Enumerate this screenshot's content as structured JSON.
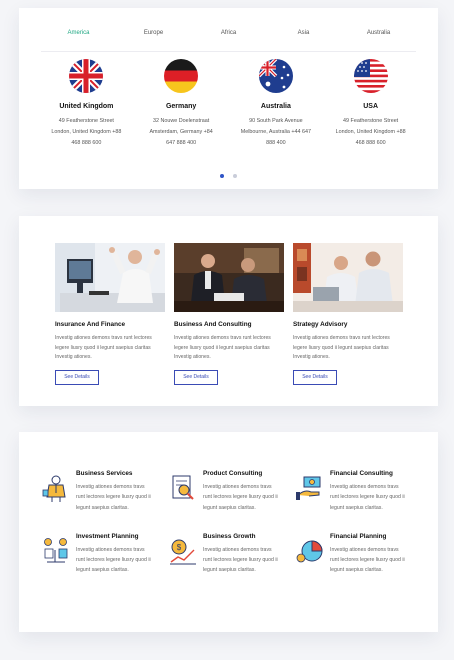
{
  "tabs": [
    "America",
    "Europe",
    "Africa",
    "Asia",
    "Australia"
  ],
  "offices": [
    {
      "name": "United Kingdom",
      "line1": "49 Featherstone Street",
      "line2": "London, United Kingdom +88",
      "line3": "468 888 600",
      "flag": "uk-flag"
    },
    {
      "name": "Germany",
      "line1": "32 Nouwe Doelenstraat",
      "line2": "Amsterdam, Germany +84",
      "line3": "647 888 400",
      "flag": "germany-flag"
    },
    {
      "name": "Australia",
      "line1": "90 South Park Avenue",
      "line2": "Melbourne, Australia +44 647",
      "line3": "888 400",
      "flag": "australia-flag"
    },
    {
      "name": "USA",
      "line1": "49 Featherstone Street",
      "line2": "London, United Kingdom +88",
      "line3": "468 888 600",
      "flag": "usa-flag"
    }
  ],
  "services": [
    {
      "title": "Insurance And Finance",
      "l1": "Investig ationes demons travs runt lectores",
      "l2": "legere liusry quod ii legunt saepius claritas",
      "l3": "Investig ationes.",
      "button": "See Details",
      "image": "office-man-celebrating-photo"
    },
    {
      "title": "Business And Consulting",
      "l1": "Investig ationes demons travs runt lectores",
      "l2": "legere liusry quod ii legunt saepius claritas",
      "l3": "Investig ationes.",
      "button": "See Details",
      "image": "business-meeting-photo"
    },
    {
      "title": "Strategy Advisory",
      "l1": "Investig ationes demons travs runt lectores",
      "l2": "legere liusry quod ii legunt saepius claritas",
      "l3": "Investig ationes.",
      "button": "See Details",
      "image": "laptop-colleagues-photo"
    }
  ],
  "features": [
    {
      "title": "Business Services",
      "l1": "Investig ationes demons travs",
      "l2": "runt lectores legere liusry quod ii",
      "l3": "legunt saepius claritas.",
      "icon": "businessman-icon"
    },
    {
      "title": "Product Consulting",
      "l1": "Investig ationes demons travs",
      "l2": "runt lectores legere liusry quod ii",
      "l3": "legunt saepius claritas.",
      "icon": "magnifier-document-icon"
    },
    {
      "title": "Financial Consulting",
      "l1": "Investig ationes demons travs",
      "l2": "runt lectores legere liusry quod ii",
      "l3": "legunt saepius claritas.",
      "icon": "money-hand-icon"
    },
    {
      "title": "Investment Planning",
      "l1": "Investig ationes demons travs",
      "l2": "runt lectores legere liusry quod ii",
      "l3": "legunt saepius claritas.",
      "icon": "investment-person-icon"
    },
    {
      "title": "Business Growth",
      "l1": "Investig ationes demons travs",
      "l2": "runt lectores legere liusry quod ii",
      "l3": "legunt saepius claritas.",
      "icon": "growth-coin-icon"
    },
    {
      "title": "Financial Planning",
      "l1": "Investig ationes demons travs",
      "l2": "runt lectores legere liusry quod ii",
      "l3": "legunt saepius claritas.",
      "icon": "pie-chart-icon"
    }
  ],
  "colors": {
    "accent": "#21a884",
    "button": "#3a4bb5",
    "dot_active": "#2f55c7"
  }
}
